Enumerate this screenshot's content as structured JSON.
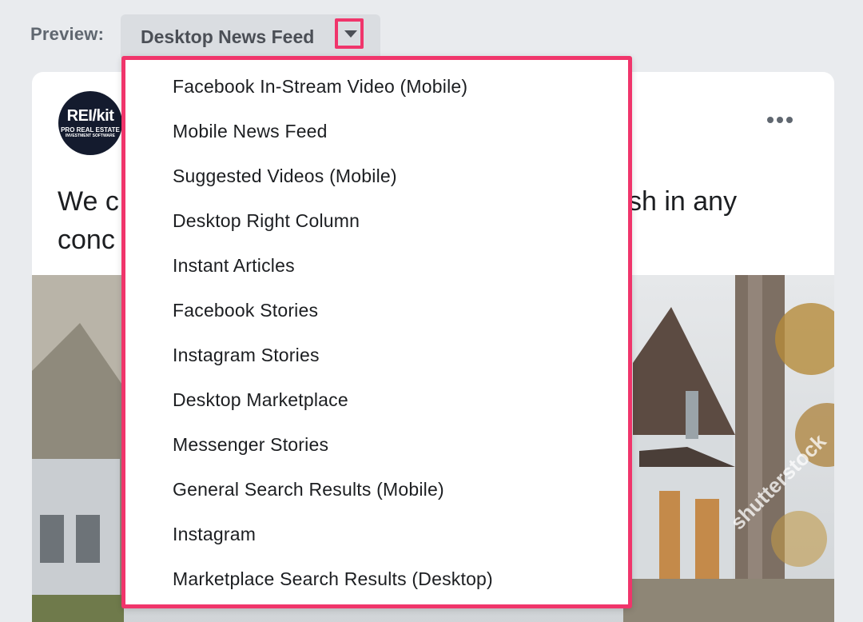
{
  "preview": {
    "label": "Preview:",
    "selected": "Desktop News Feed",
    "caret_icon": "caret-down-icon",
    "highlight_color": "#f0356b"
  },
  "ad": {
    "avatar": {
      "brand": "REI/kit",
      "line1": "PRO REAL ESTATE",
      "line2": "INVESTMENT SOFTWARE"
    },
    "more_icon": "more-horizontal-icon",
    "text_line1_start": "We c",
    "text_line1_end": "sh in any",
    "text_line2_start": "conc",
    "image_watermark": "shutterstock"
  },
  "dropdown": {
    "options": [
      "Facebook In-Stream Video (Mobile)",
      "Mobile News Feed",
      "Suggested Videos (Mobile)",
      "Desktop Right Column",
      "Instant Articles",
      "Facebook Stories",
      "Instagram Stories",
      "Desktop Marketplace",
      "Messenger Stories",
      "General Search Results (Mobile)",
      "Instagram",
      "Marketplace Search Results (Desktop)"
    ]
  }
}
